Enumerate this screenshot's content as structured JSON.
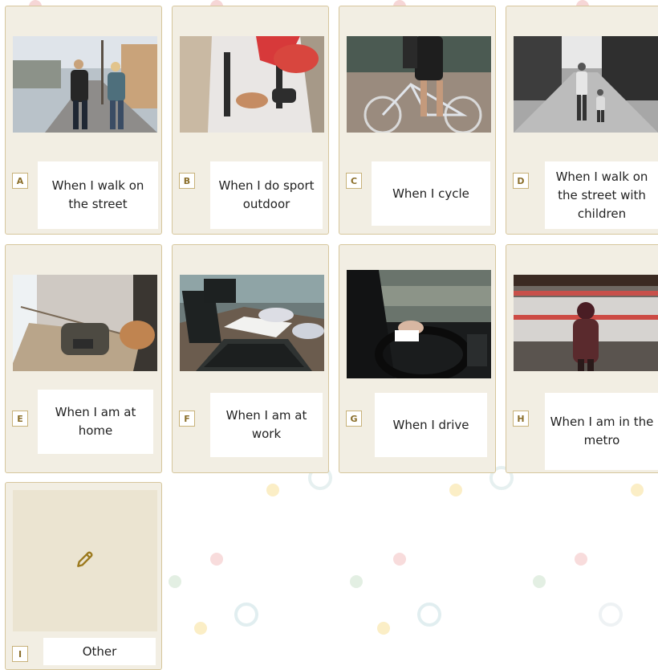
{
  "options": [
    {
      "letter": "A",
      "label": "When I walk on the street"
    },
    {
      "letter": "B",
      "label": "When I do sport outdoor"
    },
    {
      "letter": "C",
      "label": "When I cycle"
    },
    {
      "letter": "D",
      "label": "When I walk on the street with children"
    },
    {
      "letter": "E",
      "label": "When I am at home"
    },
    {
      "letter": "F",
      "label": "When I am at work"
    },
    {
      "letter": "G",
      "label": "When I drive"
    },
    {
      "letter": "H",
      "label": "When I am in the metro"
    },
    {
      "letter": "I",
      "label": "Other",
      "icon": "pencil-icon"
    }
  ],
  "colors": {
    "card_bg": "#f2eee3",
    "card_border": "#d6c69c",
    "letter_text": "#8a6e2a",
    "pencil": "#9c7a1e"
  }
}
